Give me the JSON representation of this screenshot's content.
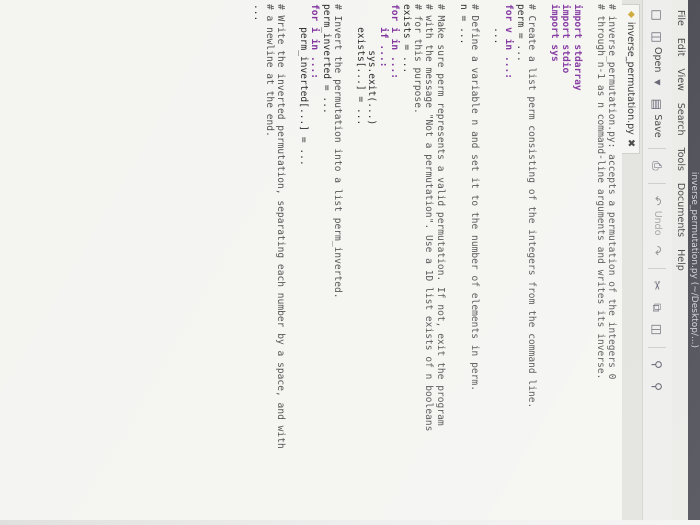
{
  "window_title": "inverse_permutation.py (~/Desktop/...)",
  "menu": [
    "File",
    "Edit",
    "View",
    "Search",
    "Tools",
    "Documents",
    "Help"
  ],
  "toolbar": {
    "open_label": "Open",
    "save_label": "Save",
    "undo_label": "Undo"
  },
  "tab": {
    "title": "inverse_permutation.py"
  },
  "code_lines": [
    "# inverse_permutation.py: accepts a permutation of the integers 0",
    "# through n-1 as n command-line arguments and writes its inverse.",
    "",
    "import stdarray",
    "import stdio",
    "import sys",
    "",
    "# Create a list perm consisting of the integers from the command line.",
    "perm = ...",
    "for v in ...:",
    "    ...",
    "",
    "# Define a variable n and set it to the number of elements in perm.",
    "n = ...",
    "",
    "# Make sure perm represents a valid permutation. If not, exit the program",
    "# with the message \"Not a permutation\". Use a 1D list exists of n booleans",
    "# for this purpose.",
    "exists = ...",
    "for i in ...:",
    "    if ...:",
    "        sys.exit(...)",
    "    exists[...] = ...",
    "",
    "# Invert the permutation into a list perm_inverted.",
    "perm_inverted = ...",
    "for i in ...:",
    "    perm_inverted[...] = ...",
    "",
    "# Write the inverted permutation, separating each number by a space, and with",
    "# a newline at the end.",
    "..."
  ]
}
